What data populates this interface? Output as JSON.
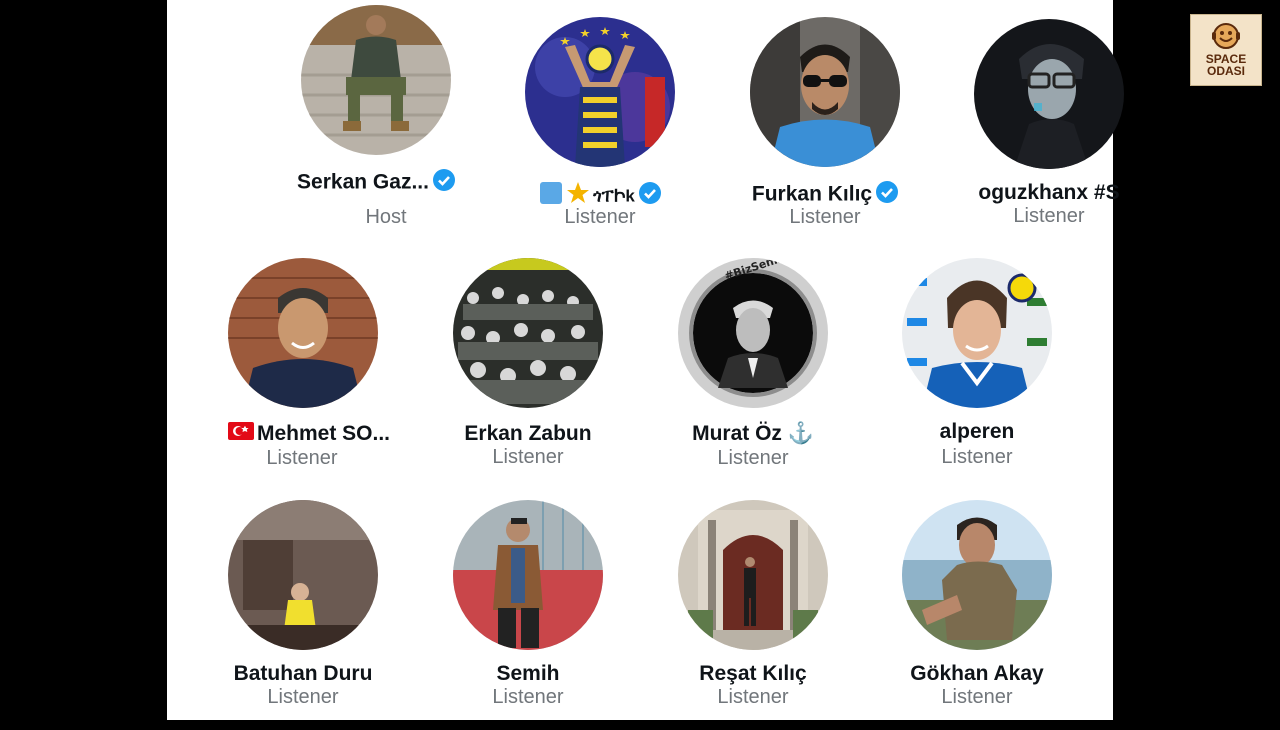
{
  "logo": {
    "line1": "SPACE",
    "line2": "ODASI",
    "icon": "smiling-microphone-logo"
  },
  "colors": {
    "verified": "#1d9bf0",
    "role_text": "#71767b",
    "name_text": "#0f1419",
    "panel": "#ffffff"
  },
  "participants": [
    {
      "name": "Serkan Gaz...",
      "role": "Host",
      "verified": true
    },
    {
      "name": "֎֎֎",
      "display": "🟦🌟ཁད",
      "role": "Listener",
      "verified": true
    },
    {
      "name": "Furkan Kılıç",
      "role": "Listener",
      "verified": true
    },
    {
      "name": "oguzkhanx #S",
      "role": "Listener",
      "verified": false
    },
    {
      "name": "Mehmet SO...",
      "role": "Listener",
      "verified": false,
      "flag": "turkey-flag-icon"
    },
    {
      "name": "Erkan Zabun",
      "role": "Listener",
      "verified": false
    },
    {
      "name": "Murat Öz ⚓",
      "role": "Listener",
      "verified": false
    },
    {
      "name": "alperen",
      "role": "Listener",
      "verified": false
    },
    {
      "name": "Batuhan Duru",
      "role": "Listener",
      "verified": false
    },
    {
      "name": "Semih",
      "role": "Listener",
      "verified": false
    },
    {
      "name": "Reşat Kılıç",
      "role": "Listener",
      "verified": false
    },
    {
      "name": "Gökhan Akay",
      "role": "Listener",
      "verified": false
    }
  ]
}
